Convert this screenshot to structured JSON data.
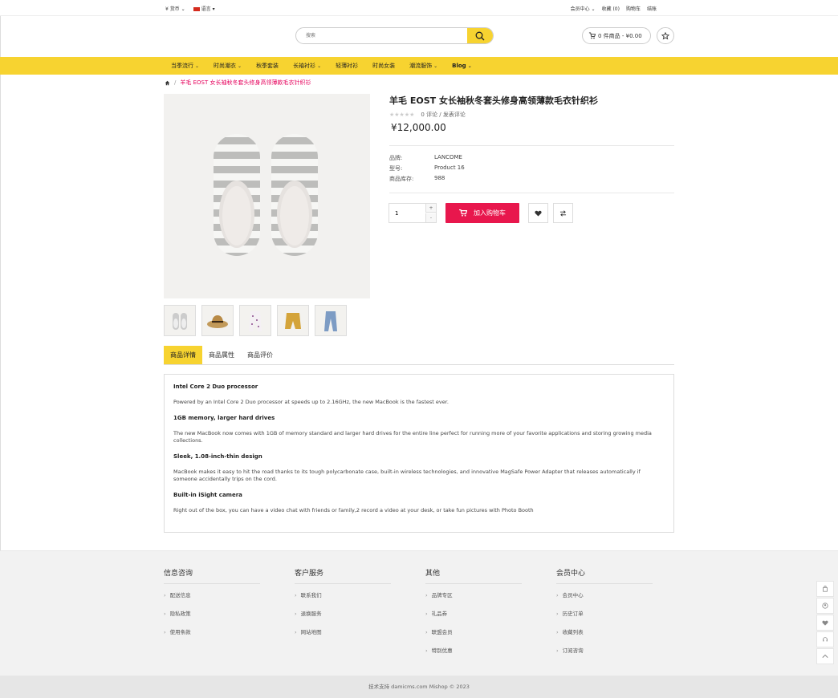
{
  "topbar": {
    "currency": "¥ 货币",
    "language": "语言",
    "links": [
      "会员中心",
      "收藏 (0)",
      "购物车",
      "结账"
    ]
  },
  "header": {
    "search_placeholder": "搜索",
    "cart_label": "0 件商品 - ¥0.00"
  },
  "nav": {
    "items": [
      {
        "label": "当季流行",
        "dropdown": true
      },
      {
        "label": "时尚潮衣",
        "dropdown": true
      },
      {
        "label": "秋季套装",
        "dropdown": false
      },
      {
        "label": "长袖衬衫",
        "dropdown": true
      },
      {
        "label": "轻薄衬衫",
        "dropdown": false
      },
      {
        "label": "时尚女装",
        "dropdown": false
      },
      {
        "label": "潮流服饰",
        "dropdown": true
      },
      {
        "label": "Blog",
        "dropdown": true
      }
    ]
  },
  "breadcrumb": {
    "current": "羊毛 EOST 女长袖秋冬套头修身高领薄款毛衣针织衫"
  },
  "product": {
    "title": "羊毛 EOST 女长袖秋冬套头修身高领薄款毛衣针织衫",
    "reviews": "0 评论 / 发表评论",
    "rating": 0,
    "price": "¥12,000.00",
    "specs": [
      {
        "key": "品牌:",
        "value": "LANCOME"
      },
      {
        "key": "型号:",
        "value": "Product 16"
      },
      {
        "key": "商品库存:",
        "value": "988"
      }
    ],
    "quantity": "1",
    "add_to_cart": "加入购物车"
  },
  "tabs": [
    {
      "label": "商品详情",
      "active": true
    },
    {
      "label": "商品属性",
      "active": false
    },
    {
      "label": "商品评价",
      "active": false
    }
  ],
  "description": [
    {
      "heading": "Intel Core 2 Duo processor",
      "text": "Powered by an Intel Core 2 Duo processor at speeds up to 2.16GHz, the new MacBook is the fastest ever."
    },
    {
      "heading": "1GB memory, larger hard drives",
      "text": "The new MacBook now comes with 1GB of memory standard and larger hard drives for the entire line perfect for running more of your favorite applications and storing growing media collections."
    },
    {
      "heading": "Sleek, 1.08-inch-thin design",
      "text": "MacBook makes it easy to hit the road thanks to its tough polycarbonate case, built-in wireless technologies, and innovative MagSafe Power Adapter that releases automatically if someone accidentally trips on the cord."
    },
    {
      "heading": "Built-in iSight camera",
      "text": "Right out of the box, you can have a video chat with friends or family,2 record a video at your desk, or take fun pictures with Photo Booth"
    }
  ],
  "footer": {
    "columns": [
      {
        "title": "信息咨询",
        "links": [
          "配送信息",
          "隐私政策",
          "使用条款"
        ]
      },
      {
        "title": "客户服务",
        "links": [
          "联系我们",
          "退换服务",
          "网站地图"
        ]
      },
      {
        "title": "其他",
        "links": [
          "品牌专区",
          "礼品券",
          "联盟会员",
          "特别优惠"
        ]
      },
      {
        "title": "会员中心",
        "links": [
          "会员中心",
          "历史订单",
          "收藏列表",
          "订阅咨询"
        ]
      }
    ],
    "copyright": "技术支持 damicms.com Mishop © 2023"
  },
  "colors": {
    "accent": "#f7d330",
    "cta": "#e8174d",
    "breadcrumb": "#e6005c"
  }
}
